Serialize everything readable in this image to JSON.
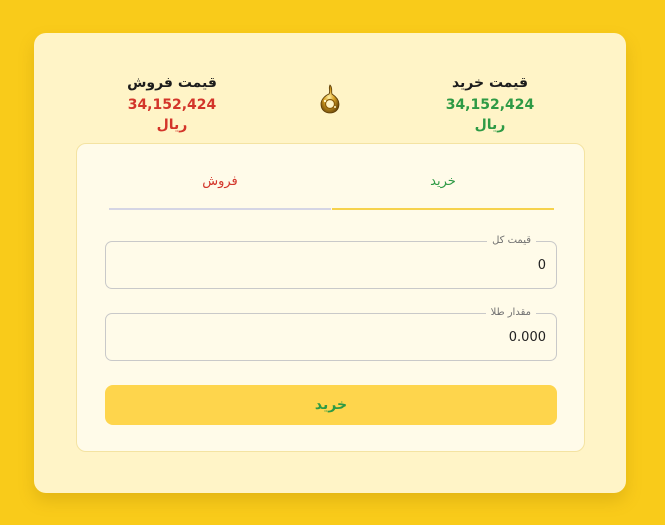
{
  "header": {
    "buy_price_title": "قیمت خرید",
    "buy_price_value": "34,152,424 ریال",
    "sell_price_title": "قیمت فروش",
    "sell_price_value": "34,152,424 ریال",
    "center_icon": "gold-jewelry-icon"
  },
  "tabs": [
    {
      "label": "خرید",
      "active": true
    },
    {
      "label": "فروش",
      "active": false
    }
  ],
  "form": {
    "total_price_label": "قیمت کل",
    "total_price_value": "0",
    "gold_amount_label": "مقدار طلا",
    "gold_amount_value": "0.000",
    "submit_label": "خرید"
  },
  "colors": {
    "background": "#f9cb1a",
    "card": "#fff4c7",
    "buy_green": "#2e9a45",
    "sell_red": "#d3352a",
    "button": "#fed54c"
  }
}
